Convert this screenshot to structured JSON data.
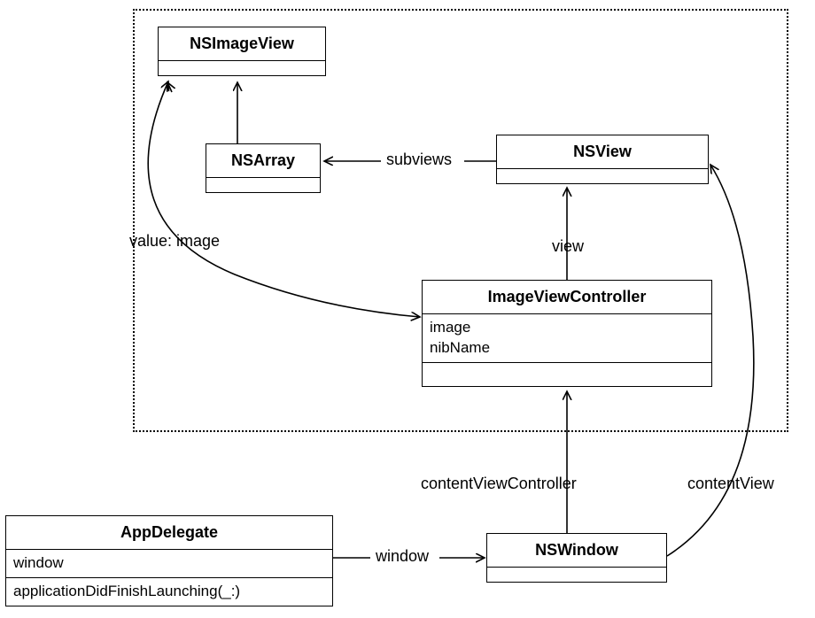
{
  "classes": {
    "nsImageView": {
      "name": "NSImageView"
    },
    "nsArray": {
      "name": "NSArray"
    },
    "nsView": {
      "name": "NSView"
    },
    "imageViewController": {
      "name": "ImageViewController",
      "attr1": "image",
      "attr2": "nibName"
    },
    "appDelegate": {
      "name": "AppDelegate",
      "attr1": "window",
      "op1": "applicationDidFinishLaunching(_:)"
    },
    "nsWindow": {
      "name": "NSWindow"
    }
  },
  "labels": {
    "subviews": "subviews",
    "view": "view",
    "valueImage": "value: image",
    "contentViewController": "contentViewController",
    "contentView": "contentView",
    "window": "window"
  }
}
